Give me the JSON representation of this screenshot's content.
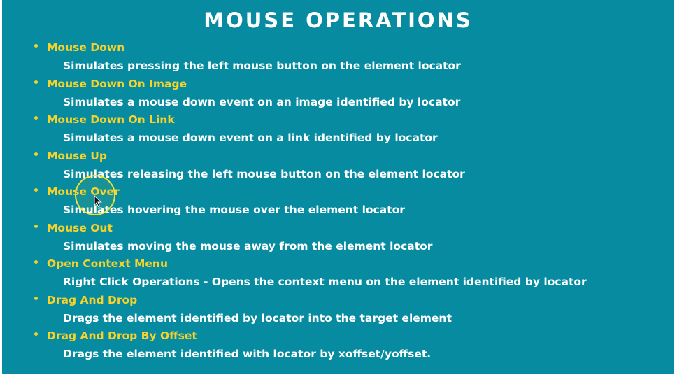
{
  "slide": {
    "title": "MOUSE OPERATIONS",
    "items": [
      {
        "heading": "Mouse Down",
        "description": "Simulates pressing the left mouse button on the element locator"
      },
      {
        "heading": "Mouse Down On Image",
        "description": "Simulates a mouse down event on an image identified by locator"
      },
      {
        "heading": "Mouse Down On Link",
        "description": "Simulates a mouse down event on a link identified by locator"
      },
      {
        "heading": "Mouse Up",
        "description": "Simulates releasing the left mouse button on the element locator"
      },
      {
        "heading": "Mouse Over",
        "description": "Simulates hovering the mouse over the element locator"
      },
      {
        "heading": "Mouse Out",
        "description": "Simulates moving the mouse away from the element locator"
      },
      {
        "heading": "Open Context Menu",
        "description": "Right Click Operations - Opens the context menu on the element identified by locator"
      },
      {
        "heading": "Drag And Drop",
        "description": "Drags the element identified by locator into the target element"
      },
      {
        "heading": "Drag And Drop By Offset",
        "description": "Drags the element identified with locator by xoffset/yoffset."
      }
    ]
  },
  "colors": {
    "background": "#068ba0",
    "heading": "#f7d22a",
    "text": "#ffffff",
    "cursor_highlight": "#f0e03a"
  },
  "icons": {
    "bullet": "bullet-dot",
    "cursor": "mouse-pointer-icon",
    "highlight": "cursor-highlight-circle"
  }
}
